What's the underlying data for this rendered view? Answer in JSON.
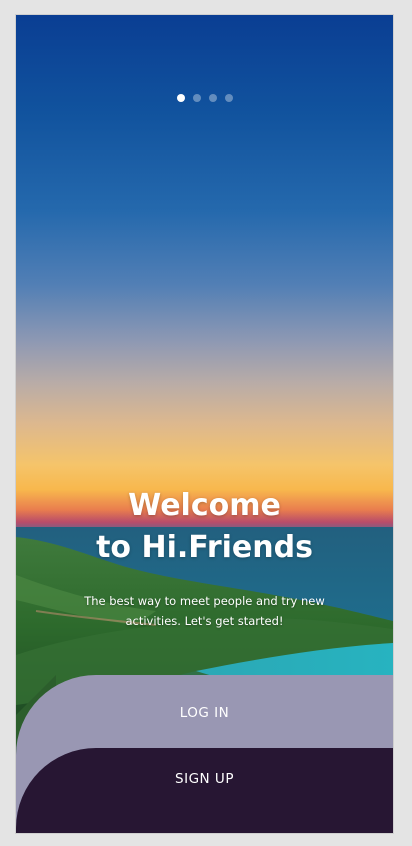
{
  "carousel": {
    "dots": 4,
    "active_index": 0
  },
  "welcome": {
    "title_line1": "Welcome",
    "title_line2": "to Hi.Friends",
    "subtitle_line1": "The best way to meet people and try new",
    "subtitle_line2": "activities. Let's get started!"
  },
  "actions": {
    "login_label": "LOG IN",
    "signup_label": "SIGN UP"
  },
  "colors": {
    "login_bg": "#9997b3",
    "signup_bg": "#271633",
    "text": "#ffffff"
  }
}
